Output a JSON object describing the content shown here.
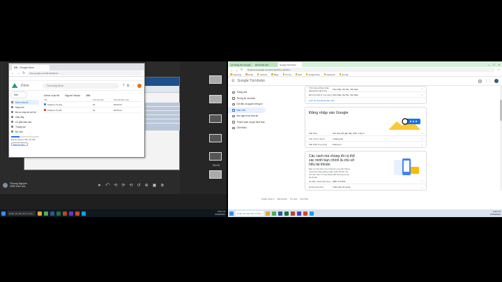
{
  "left": {
    "drive": {
      "tab_title": "Bắt - Google Drive",
      "url": "drive.google.com/drive/folders/...",
      "app_title": "Drive",
      "search_placeholder": "Tìm trong Drive",
      "new_button": "Mới",
      "sidebar": [
        "Drive của tôi",
        "Máy tính",
        "Được chia sẻ với tôi",
        "Gần đây",
        "Có gắn dấu sao",
        "Thùng rác",
        "Bộ nhớ"
      ],
      "storage_text": "Đã sử dụng 0 GB / 15 GB",
      "buy_storage": "Mua bộ nhớ",
      "breadcrumb": [
        "Drive của tôi",
        "Người thuộc",
        "Bắt"
      ],
      "columns": [
        "Tên",
        "Chủ sở hữu",
        "Sửa đổi lần cuối"
      ],
      "files": [
        {
          "name": "Capture (7).png",
          "owner": "tôi",
          "modified": "00:00 tôi"
        },
        {
          "name": "Capture (7).pdf",
          "owner": "tôi",
          "modified": "00:00 tôi"
        }
      ]
    },
    "thumb_label": "25:04",
    "user": {
      "name": "Thuong Nguyen",
      "sub": "0905 Kiến trúc"
    },
    "controls": [
      "➤",
      "⤺",
      "⟲",
      "⟳",
      "⟲",
      "↺",
      "⊕",
      "▣",
      "⊗"
    ],
    "taskbar": {
      "search": "Nhập vào đây để tìm kiếm",
      "time": "9:30 CH",
      "date": "21/06/2021"
    }
  },
  "right": {
    "tabs": [
      "(2) Trang chủ Google",
      "Ghi lại bài viết",
      "Google Tài khoản"
    ],
    "url": "myaccount.google.com/security?utm_source=...",
    "bookmarks": [
      "Ứng dụng",
      "Gmail",
      "YouTube",
      "Maps",
      "Tin tức",
      "Dịch",
      "Google Drive",
      "Facebook",
      "Học tập"
    ],
    "header_title": "Google Tài khoản",
    "sidebar": [
      "Trang chủ",
      "Thông tin cá nhân",
      "Dữ liệu và quyền riêng tư",
      "Bảo mật",
      "Mọi người và chia sẻ",
      "Thanh toán và gói thuê bao",
      "Giới thiệu"
    ],
    "top_card": [
      {
        "label": "Tình trạng đăng nhập bằng bảo mật 2 lớp",
        "value": "Cầu Giấy, Hà Nội, Việt Nam"
      },
      {
        "label": "Đã xóa thiết bị ứng dụng",
        "value": "Cầu Giấy, Hà Nội, Việt Nam"
      }
    ],
    "top_link": "Xem lại hoạt động bảo mật",
    "signin_title": "Đăng nhập vào Google",
    "signin_rows": [
      {
        "label": "Mật khẩu",
        "value": "Lần thay đổi gần đây nhất: 1 thg 3"
      },
      {
        "label": "Xác minh 2 bước",
        "value": "Đang bật"
      },
      {
        "label": "Mật khẩu ứng dụng",
        "value": "Không có"
      }
    ],
    "verify_title": "Các cách mà chúng tôi có thể xác minh bạn chính là chủ sở hữu tài khoản",
    "verify_sub": "Bạn có thể dùng các thông tin này để chứng minh bạn đang đăng nhập hoặc để liên hệ với bạn nếu có hoạt động bất thường trong tài khoản.",
    "verify_rows": [
      {
        "label": "Số điện thoại khôi phục",
        "value": "0987 173 818"
      },
      {
        "label": "Email khôi phục",
        "value": "Thêm địa chỉ email"
      }
    ],
    "footer": [
      "Quyền riêng tư",
      "Điều khoản",
      "Trợ giúp",
      "Giới thiệu"
    ],
    "taskbar": {
      "search": "Nhập vào đây để tìm kiếm",
      "time": "9:30 CH",
      "date": "21/06/2021"
    }
  }
}
